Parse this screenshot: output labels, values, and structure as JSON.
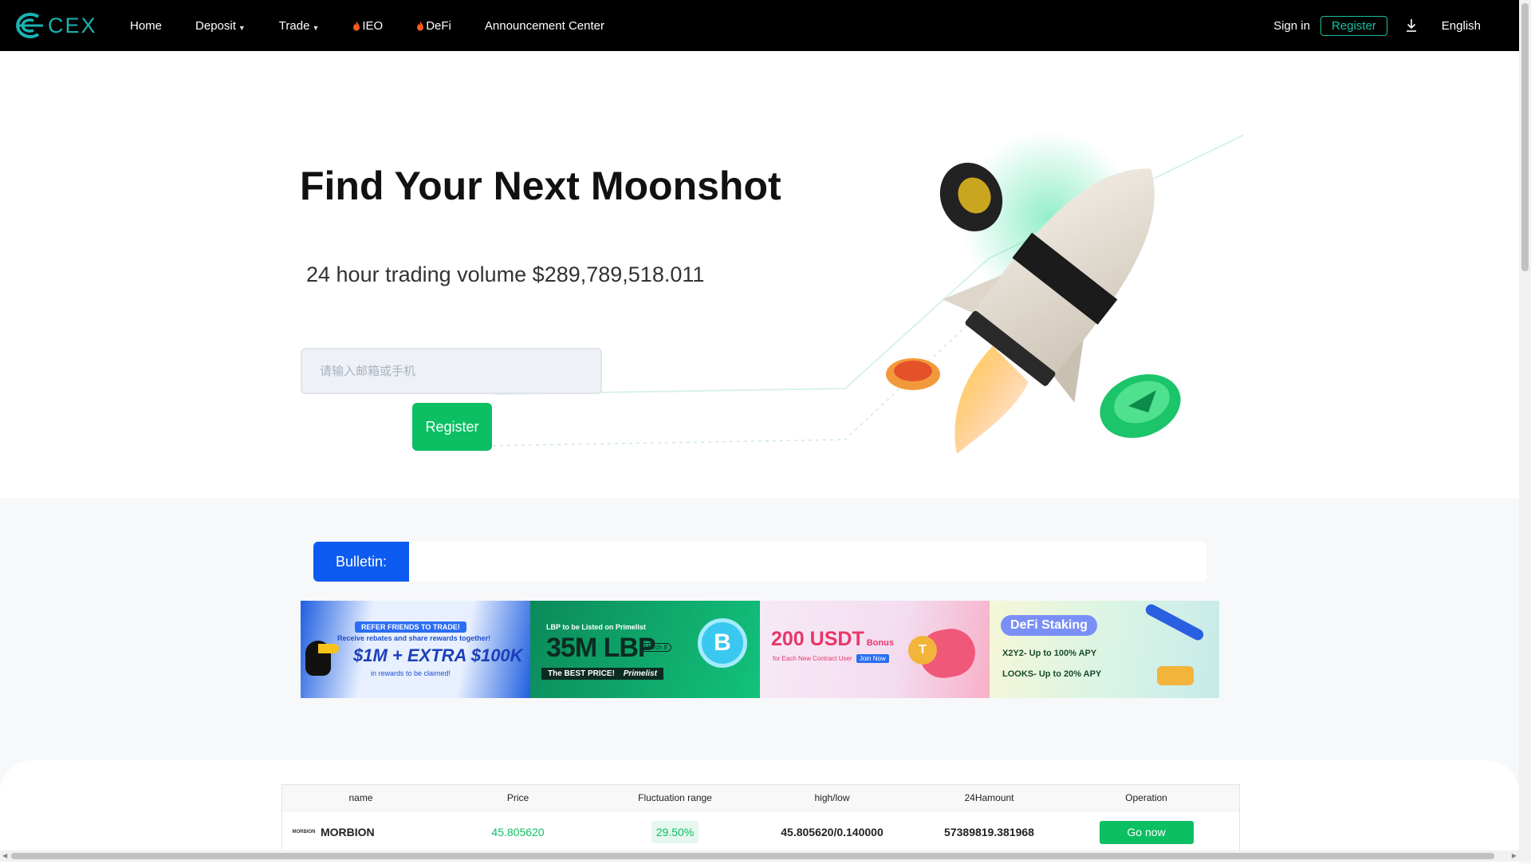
{
  "header": {
    "logo_text": "CEX",
    "nav": [
      {
        "label": "Home",
        "has_caret": false,
        "hot": false
      },
      {
        "label": "Deposit",
        "has_caret": true,
        "hot": false
      },
      {
        "label": "Trade",
        "has_caret": true,
        "hot": false
      },
      {
        "label": "IEO",
        "has_caret": false,
        "hot": true
      },
      {
        "label": "DeFi",
        "has_caret": false,
        "hot": true
      },
      {
        "label": "Announcement Center",
        "has_caret": false,
        "hot": false
      }
    ],
    "signin_label": "Sign in",
    "register_label": "Register",
    "download_icon": "download-icon",
    "language": "English"
  },
  "hero": {
    "title": "Find Your Next Moonshot",
    "volume_text": "24 hour trading volume $289,789,518.011",
    "input_placeholder": "请输入邮箱或手机",
    "input_value": "",
    "register_label": "Register"
  },
  "bulletin": {
    "label": "Bulletin:",
    "text": ""
  },
  "banners": [
    {
      "line1": "REFER FRIENDS TO TRADE!",
      "line2": "Receive rebates and share rewards together!",
      "headline": "$1M + EXTRA $100K",
      "line3": "in rewards to be claimed!"
    },
    {
      "line1": "LBP to be Listed on Primelist",
      "headline": "35M LBP",
      "date": "March 8",
      "line2": "The BEST PRICE!",
      "brand": "Primelist"
    },
    {
      "headline": "200 USDT",
      "suffix": "Bonus",
      "line1": "for Each New Contract User",
      "cta": "Join Now"
    },
    {
      "headline": "DeFi Staking",
      "line1": "X2Y2- Up to 100% APY",
      "line2": "LOOKS- Up to 20% APY"
    }
  ],
  "market_table": {
    "columns": [
      "name",
      "Price",
      "Fluctuation range",
      "high/low",
      "24Hamount",
      "Operation"
    ],
    "rows": [
      {
        "logo": "MORBION",
        "name": "MORBION",
        "price": "45.805620",
        "change": "29.50%",
        "high_low": "45.805620/0.140000",
        "amount": "57389819.381968",
        "action": "Go now"
      }
    ]
  },
  "colors": {
    "header_bg": "#000000",
    "brand_teal": "#17c0a0",
    "primary_green": "#0bbf62",
    "bulletin_blue": "#0d5bf0"
  }
}
